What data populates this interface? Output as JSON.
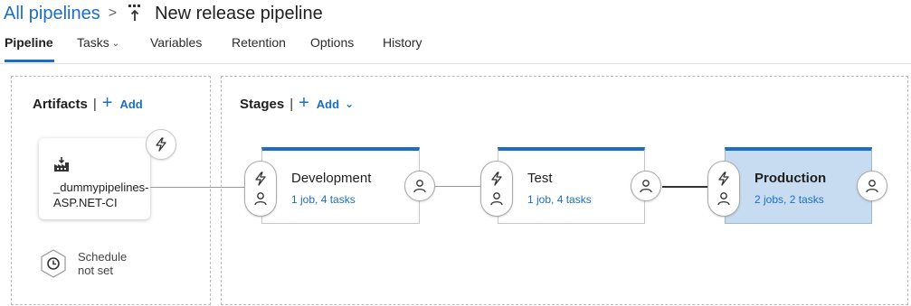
{
  "breadcrumb": {
    "parent": "All pipelines",
    "separator": ">",
    "title": "New release pipeline"
  },
  "tabs": [
    {
      "label": "Pipeline",
      "active": true
    },
    {
      "label": "Tasks",
      "has_dropdown": true
    },
    {
      "label": "Variables"
    },
    {
      "label": "Retention"
    },
    {
      "label": "Options"
    },
    {
      "label": "History"
    }
  ],
  "artifacts": {
    "title": "Artifacts",
    "add_label": "Add",
    "artifact_name_line1": "_dummypipelines-",
    "artifact_name_line2": "ASP.NET-CI",
    "icon": "build-artifact-icon",
    "trigger_icon": "lightning-icon"
  },
  "schedule": {
    "line1": "Schedule",
    "line2": "not set",
    "icon": "clock-icon"
  },
  "stages_section": {
    "title": "Stages",
    "add_label": "Add"
  },
  "stages": [
    {
      "name": "Development",
      "summary": "1 job, 4 tasks",
      "selected": false
    },
    {
      "name": "Test",
      "summary": "1 job, 4 tasks",
      "selected": false
    },
    {
      "name": "Production",
      "summary": "2 jobs, 2 tasks",
      "selected": true
    }
  ],
  "colors": {
    "accent": "#1a6fc4",
    "selected_stage_bg": "#c7dcf1"
  }
}
